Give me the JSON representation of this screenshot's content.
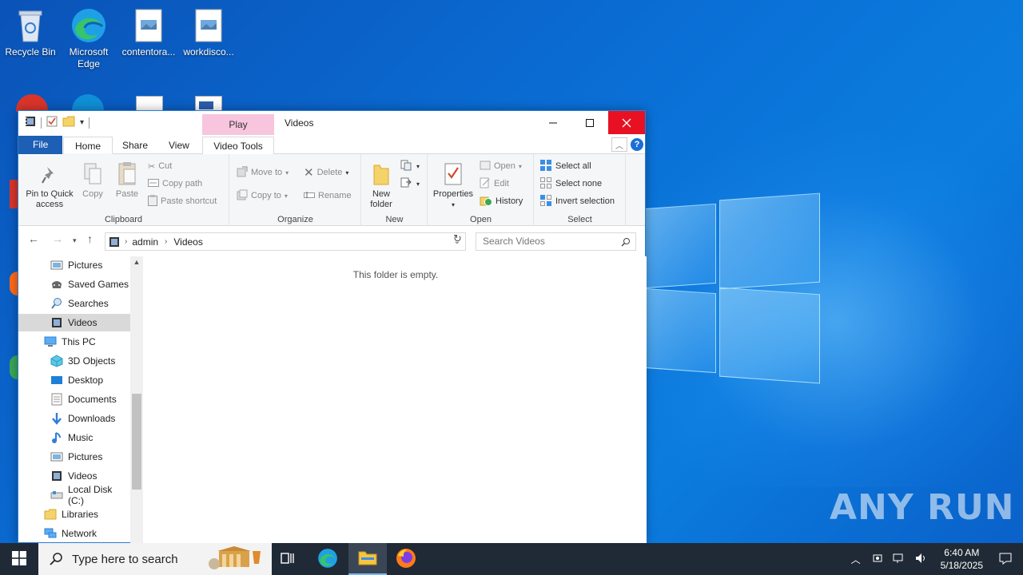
{
  "desktop": {
    "icons": [
      {
        "label": "Recycle Bin"
      },
      {
        "label": "Microsoft Edge"
      },
      {
        "label": "contentora..."
      },
      {
        "label": "workdisco..."
      }
    ],
    "watermark": "ANY RUN"
  },
  "window": {
    "title": "Videos",
    "context_tab": "Play",
    "context_group": "Video Tools",
    "tabs": [
      "File",
      "Home",
      "Share",
      "View"
    ],
    "ribbon": {
      "clipboard": {
        "label": "Clipboard",
        "pin": "Pin to Quick access",
        "copy": "Copy",
        "paste": "Paste",
        "cut": "Cut",
        "copy_path": "Copy path",
        "paste_shortcut": "Paste shortcut"
      },
      "organize": {
        "label": "Organize",
        "move_to": "Move to",
        "copy_to": "Copy to",
        "delete": "Delete",
        "rename": "Rename"
      },
      "new": {
        "label": "New",
        "new_folder": "New folder"
      },
      "open": {
        "label": "Open",
        "properties": "Properties",
        "open": "Open",
        "edit": "Edit",
        "history": "History"
      },
      "select": {
        "label": "Select",
        "select_all": "Select all",
        "select_none": "Select none",
        "invert": "Invert selection"
      }
    },
    "address": {
      "segments": [
        "admin",
        "Videos"
      ]
    },
    "search_placeholder": "Search Videos",
    "nav_tree": [
      {
        "label": "Pictures",
        "icon": "pictures-icon"
      },
      {
        "label": "Saved Games",
        "icon": "saved-games-icon"
      },
      {
        "label": "Searches",
        "icon": "searches-icon"
      },
      {
        "label": "Videos",
        "icon": "videos-icon",
        "selected": true
      },
      {
        "label": "This PC",
        "icon": "this-pc-icon"
      },
      {
        "label": "3D Objects",
        "icon": "3d-objects-icon"
      },
      {
        "label": "Desktop",
        "icon": "desktop-icon"
      },
      {
        "label": "Documents",
        "icon": "documents-icon"
      },
      {
        "label": "Downloads",
        "icon": "downloads-icon"
      },
      {
        "label": "Music",
        "icon": "music-icon"
      },
      {
        "label": "Pictures",
        "icon": "pictures-icon"
      },
      {
        "label": "Videos",
        "icon": "videos-icon"
      },
      {
        "label": "Local Disk (C:)",
        "icon": "local-disk-icon"
      },
      {
        "label": "Libraries",
        "icon": "libraries-icon"
      },
      {
        "label": "Network",
        "icon": "network-icon"
      }
    ],
    "empty_message": "This folder is empty."
  },
  "taskbar": {
    "search_placeholder": "Type here to search",
    "time": "6:40 AM",
    "date": "5/18/2025"
  },
  "colors": {
    "accent": "#1c5fb4",
    "close_red": "#e81123",
    "play_context": "#f7c5dd",
    "taskbar": "#1f2a36"
  }
}
